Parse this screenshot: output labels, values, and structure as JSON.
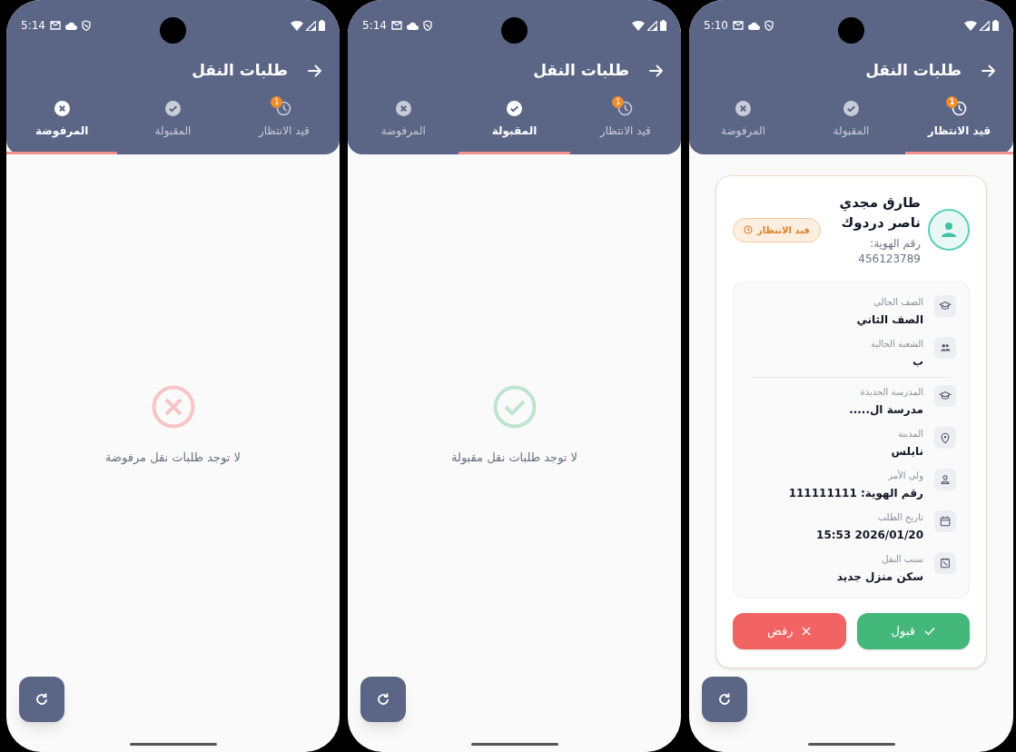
{
  "screens": [
    {
      "status_bar": {
        "time": "5:10"
      },
      "title": "طلبات النقل",
      "tabs": [
        {
          "label": "قيد الانتظار",
          "selected": true,
          "badge": "1"
        },
        {
          "label": "المقبولة",
          "selected": false
        },
        {
          "label": "المرفوضة",
          "selected": false
        }
      ],
      "content": {
        "kind": "request-card",
        "name": "طارق مجدي ناصر دردوك",
        "id_line": "رقم الهوية: 456123789",
        "status": "قيد الانتظار",
        "groups": [
          {
            "items": [
              {
                "kind": "grade",
                "label": "الصف الحالي",
                "value": "الصف الثاني"
              },
              {
                "kind": "section",
                "label": "الشعبة الحالية",
                "value": "ب"
              }
            ]
          },
          {
            "items": [
              {
                "kind": "school",
                "label": "المدرسة الجديدة",
                "value": "مدرسة ال....."
              },
              {
                "kind": "city",
                "label": "المدينة",
                "value": "نابلس"
              },
              {
                "kind": "guardian",
                "label": "ولي الأمر",
                "value": "رقم الهوية: 111111111"
              },
              {
                "kind": "date",
                "label": "تاريخ الطلب",
                "value": "2026/01/20 15:53"
              },
              {
                "kind": "reason",
                "label": "سبب النقل",
                "value": "سكن منزل جديد"
              }
            ]
          }
        ],
        "accept": "قبول",
        "reject": "رفض"
      }
    },
    {
      "status_bar": {
        "time": "5:14"
      },
      "title": "طلبات النقل",
      "tabs": [
        {
          "label": "قيد الانتظار",
          "selected": false,
          "badge": "1"
        },
        {
          "label": "المقبولة",
          "selected": true
        },
        {
          "label": "المرفوضة",
          "selected": false
        }
      ],
      "content": {
        "kind": "empty-accepted",
        "message": "لا توجد طلبات نقل مقبولة"
      }
    },
    {
      "status_bar": {
        "time": "5:14"
      },
      "title": "طلبات النقل",
      "tabs": [
        {
          "label": "قيد الانتظار",
          "selected": false,
          "badge": "1"
        },
        {
          "label": "المقبولة",
          "selected": false
        },
        {
          "label": "المرفوضة",
          "selected": true
        }
      ],
      "content": {
        "kind": "empty-rejected",
        "message": "لا توجد طلبات نقل مرفوضة"
      }
    }
  ]
}
